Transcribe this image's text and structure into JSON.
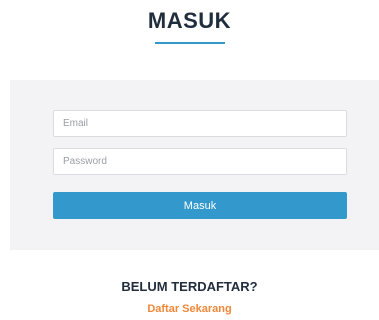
{
  "header": {
    "title": "MASUK"
  },
  "form": {
    "email_placeholder": "Email",
    "password_placeholder": "Password",
    "submit_label": "Masuk"
  },
  "footer": {
    "prompt": "BELUM TERDAFTAR?",
    "register_link": "Daftar Sekarang"
  },
  "colors": {
    "title": "#1f2d3d",
    "accent": "#3399cc",
    "panel_bg": "#f3f3f5",
    "link": "#f0883a"
  }
}
